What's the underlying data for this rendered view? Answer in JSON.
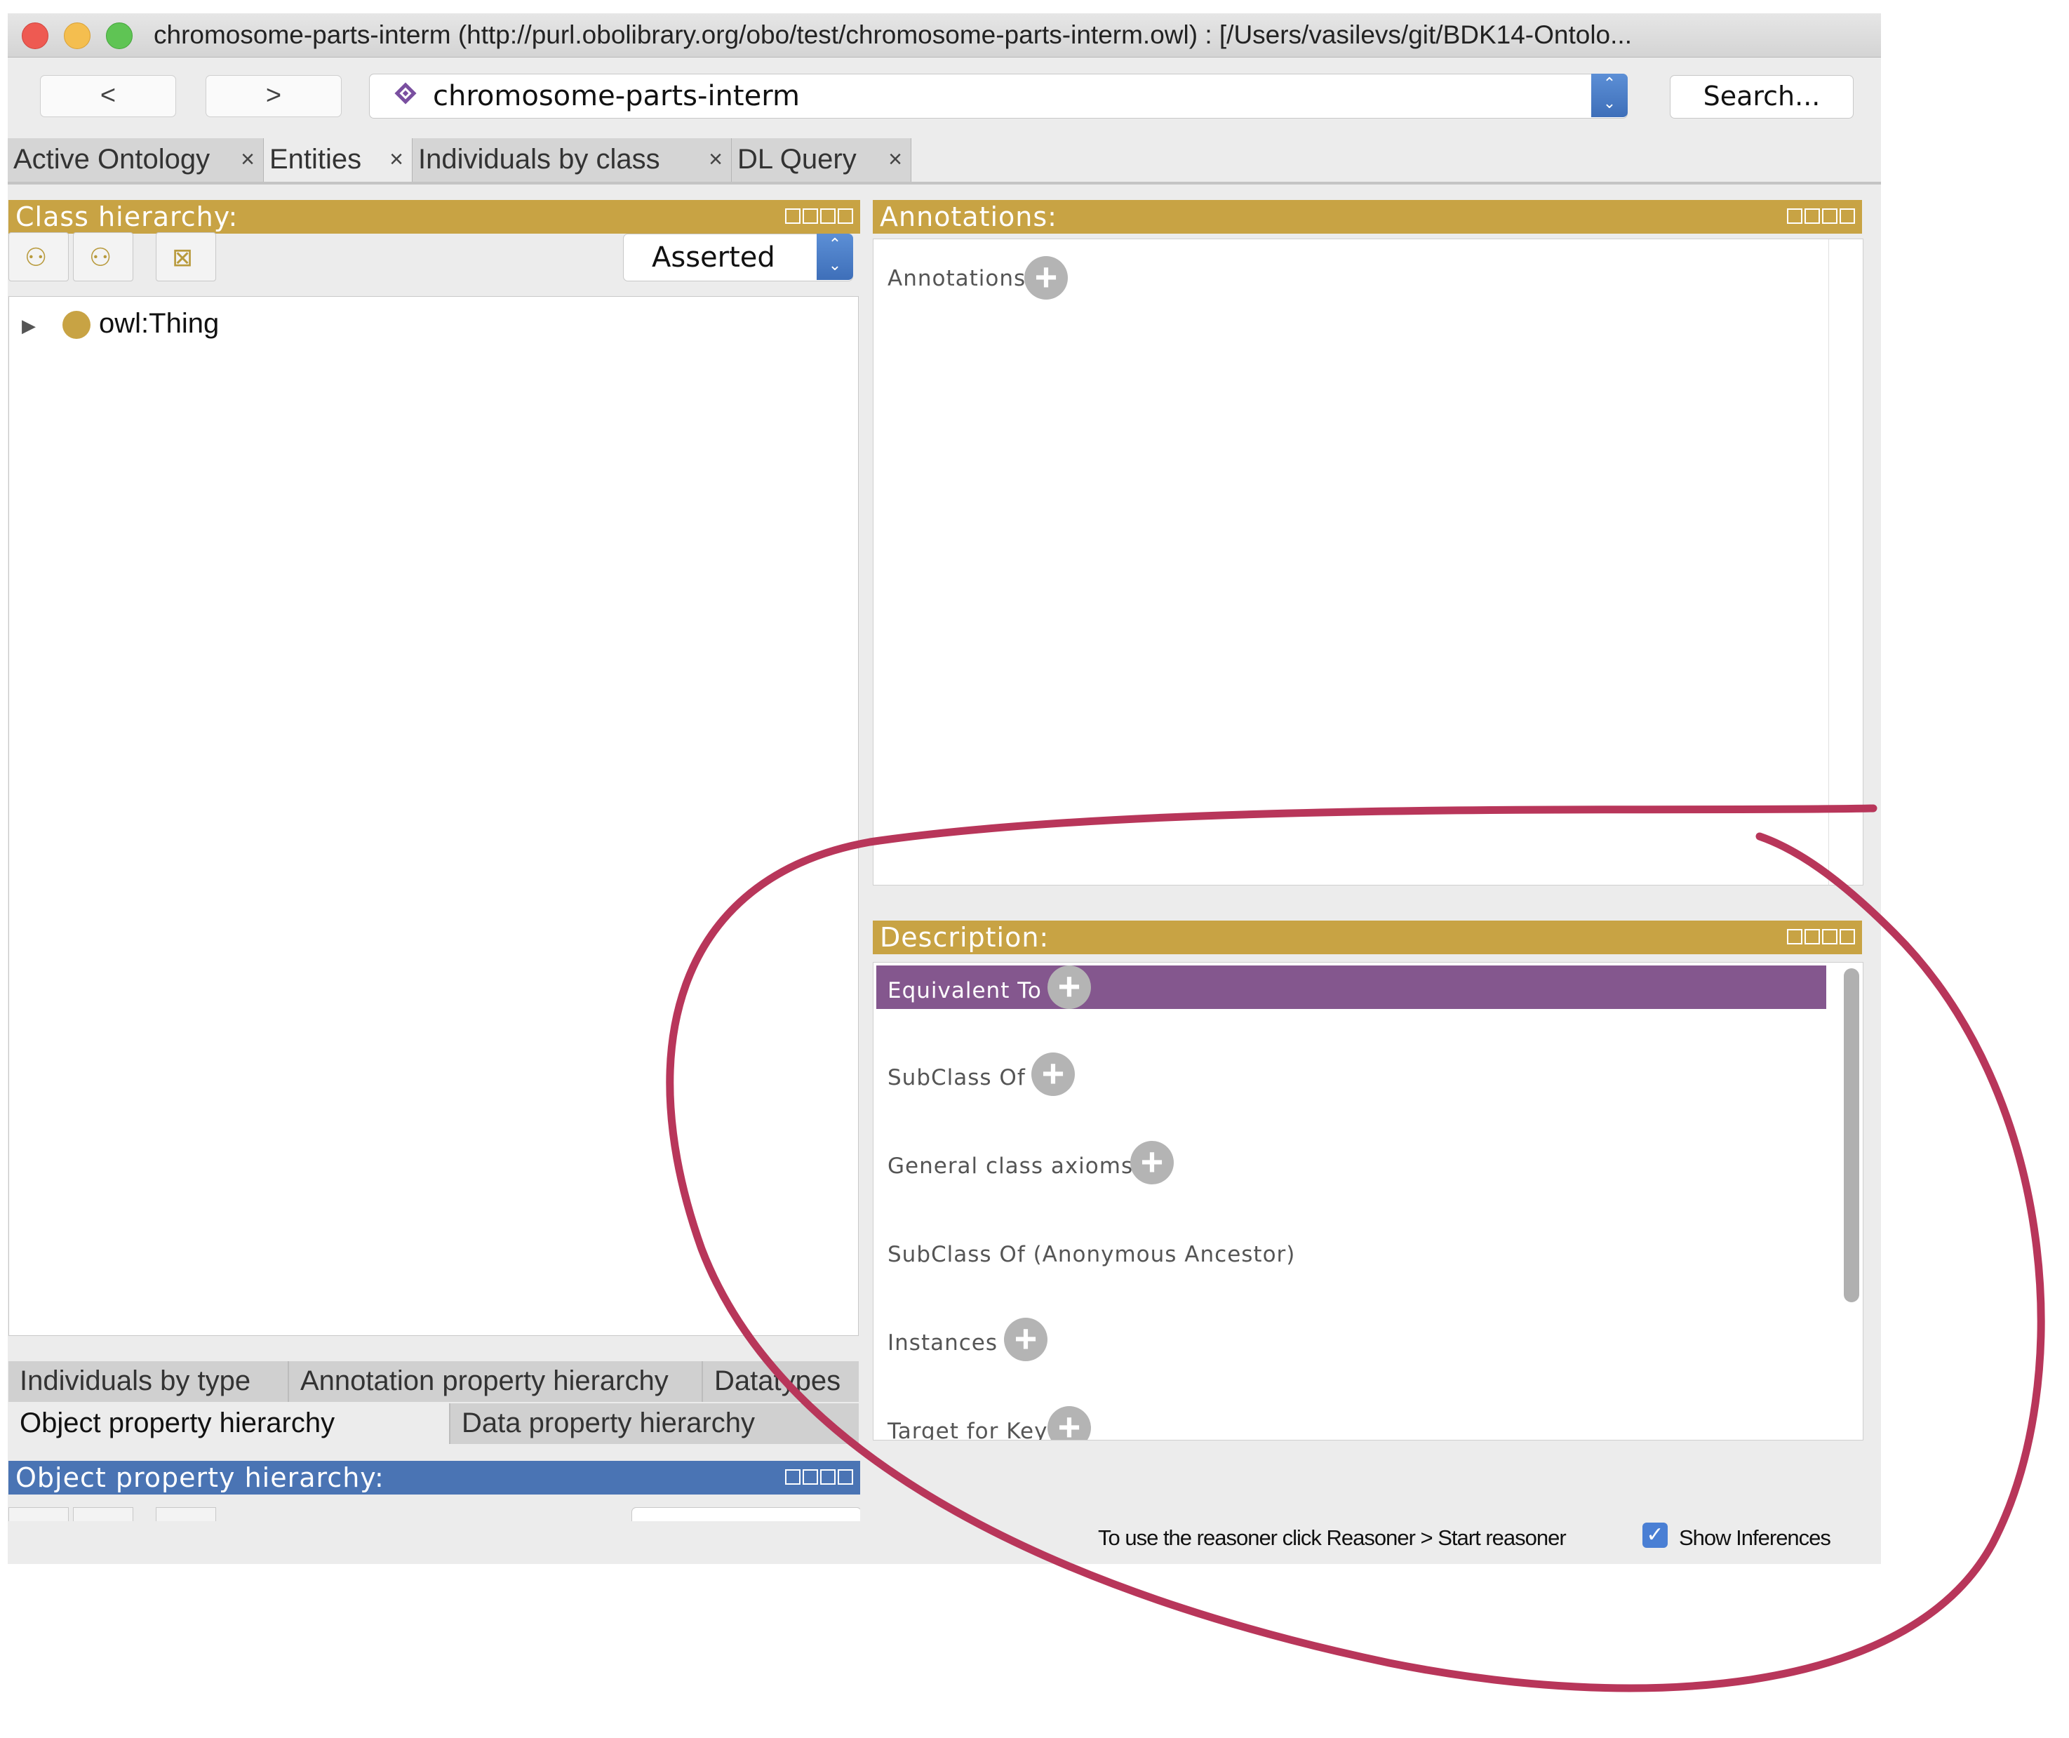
{
  "window": {
    "title": "chromosome-parts-interm (http://purl.obolibrary.org/obo/test/chromosome-parts-interm.owl)  : [/Users/vasilevs/git/BDK14-Ontolo..."
  },
  "toolbar": {
    "back_label": "<",
    "forward_label": ">",
    "ontology_selector": "chromosome-parts-interm",
    "search_label": "Search..."
  },
  "tabs": [
    {
      "label": "Active Ontology",
      "close": "×"
    },
    {
      "label": "Entities",
      "close": "×"
    },
    {
      "label": "Individuals by class",
      "close": "×"
    },
    {
      "label": "DL Query",
      "close": "×"
    }
  ],
  "class_hierarchy": {
    "header": "Class hierarchy:",
    "mode": "Asserted",
    "root": "owl:Thing",
    "icons": [
      "add-subclass-icon",
      "add-sibling-class-icon",
      "delete-class-icon"
    ]
  },
  "bottom_tabs": {
    "row1": [
      "Individuals by type",
      "Annotation property hierarchy",
      "Datatypes"
    ],
    "row2": [
      "Object property hierarchy",
      "Data property hierarchy"
    ]
  },
  "object_property_hierarchy": {
    "header": "Object property hierarchy:"
  },
  "annotations": {
    "header": "Annotations:",
    "label": "Annotations"
  },
  "description": {
    "header": "Description:",
    "sections": [
      "Equivalent To",
      "SubClass Of",
      "General class axioms",
      "SubClass Of (Anonymous Ancestor)",
      "Instances",
      "Target for Key"
    ]
  },
  "status": {
    "reasoner_hint": "To use the reasoner click Reasoner > Start reasoner",
    "show_inferences_label": "Show Inferences",
    "show_inferences_checked": true
  },
  "colors": {
    "view_header": "#c8a344",
    "object_property_header": "#4a74b4",
    "selected_section": "#84578e",
    "annotation_circle": "#b8365a"
  }
}
